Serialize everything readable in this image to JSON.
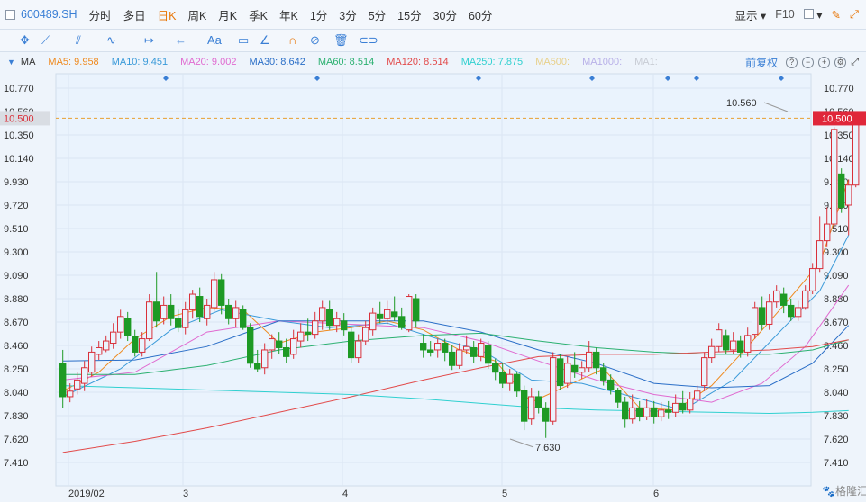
{
  "toolbar": {
    "symbol": "600489.SH",
    "periods": [
      "分时",
      "多日",
      "日K",
      "周K",
      "月K",
      "季K",
      "年K",
      "1分",
      "3分",
      "5分",
      "15分",
      "30分",
      "60分"
    ],
    "active_period": "日K",
    "display_label": "显示",
    "f10_label": "F10"
  },
  "drawing_tools": [
    "crosshair-icon",
    "line-icon",
    "channel-icon",
    "wave-icon",
    "range-icon",
    "arrow-icon",
    "text-icon",
    "comment-icon",
    "ruler-icon",
    "magnet-icon",
    "hide-icon",
    "delete-icon",
    "link-icon"
  ],
  "ma_bar": {
    "label": "MA",
    "items": [
      {
        "text": "MA5: 9.958",
        "color": "#ef8a1f"
      },
      {
        "text": "MA10: 9.451",
        "color": "#3a9ad9"
      },
      {
        "text": "MA20: 9.002",
        "color": "#e06ad0"
      },
      {
        "text": "MA30: 8.642",
        "color": "#2a6ec7"
      },
      {
        "text": "MA60: 8.514",
        "color": "#2bb070"
      },
      {
        "text": "MA120: 8.514",
        "color": "#e24a4a"
      },
      {
        "text": "MA250: 7.875",
        "color": "#30d0d0"
      },
      {
        "text": "MA500:",
        "color": "#e8d08a"
      },
      {
        "text": "MA1000:",
        "color": "#b8b0e8"
      },
      {
        "text": "MA1:",
        "color": "#c8ccd4"
      }
    ],
    "adjust_label": "前复权"
  },
  "chart_data": {
    "type": "candlestick",
    "y_ticks": [
      "10.770",
      "10.560",
      "10.350",
      "10.140",
      "9.930",
      "9.720",
      "9.510",
      "9.300",
      "9.090",
      "8.880",
      "8.670",
      "8.460",
      "8.250",
      "8.040",
      "7.830",
      "7.620",
      "7.410"
    ],
    "ylim": [
      7.3,
      10.85
    ],
    "x_labels": [
      "2019/02",
      "3",
      "4",
      "5",
      "6"
    ],
    "current_price_label": "10.500",
    "current_price": 10.5,
    "annotations": [
      {
        "text": "10.560",
        "value": 10.56
      },
      {
        "text": "7.630",
        "value": 7.63
      }
    ],
    "candles": [
      [
        8.3,
        8.0,
        8.42,
        7.9
      ],
      [
        8.0,
        8.05,
        8.12,
        7.95
      ],
      [
        8.07,
        8.15,
        8.22,
        8.02
      ],
      [
        8.12,
        8.26,
        8.32,
        8.05
      ],
      [
        8.22,
        8.4,
        8.45,
        8.18
      ],
      [
        8.38,
        8.44,
        8.5,
        8.33
      ],
      [
        8.42,
        8.5,
        8.55,
        8.4
      ],
      [
        8.48,
        8.58,
        8.66,
        8.43
      ],
      [
        8.58,
        8.72,
        8.78,
        8.52
      ],
      [
        8.7,
        8.55,
        8.76,
        8.5
      ],
      [
        8.54,
        8.4,
        8.6,
        8.36
      ],
      [
        8.4,
        8.52,
        8.58,
        8.36
      ],
      [
        8.52,
        8.85,
        8.92,
        8.5
      ],
      [
        8.85,
        8.68,
        9.12,
        8.62
      ],
      [
        8.7,
        8.82,
        8.9,
        8.65
      ],
      [
        8.82,
        8.7,
        8.92,
        8.64
      ],
      [
        8.7,
        8.62,
        8.78,
        8.58
      ],
      [
        8.62,
        8.78,
        8.85,
        8.56
      ],
      [
        8.78,
        8.92,
        8.96,
        8.7
      ],
      [
        8.9,
        8.72,
        8.98,
        8.67
      ],
      [
        8.7,
        8.82,
        8.88,
        8.64
      ],
      [
        8.8,
        9.05,
        9.12,
        8.77
      ],
      [
        9.05,
        8.82,
        9.1,
        8.74
      ],
      [
        8.82,
        8.7,
        8.88,
        8.65
      ],
      [
        8.7,
        8.8,
        8.86,
        8.62
      ],
      [
        8.78,
        8.62,
        8.82,
        8.6
      ],
      [
        8.62,
        8.3,
        8.66,
        8.26
      ],
      [
        8.3,
        8.25,
        8.42,
        8.22
      ],
      [
        8.26,
        8.42,
        8.48,
        8.2
      ],
      [
        8.42,
        8.52,
        8.56,
        8.34
      ],
      [
        8.5,
        8.44,
        8.58,
        8.38
      ],
      [
        8.44,
        8.36,
        8.52,
        8.3
      ],
      [
        8.38,
        8.52,
        8.6,
        8.34
      ],
      [
        8.5,
        8.58,
        8.66,
        8.44
      ],
      [
        8.58,
        8.56,
        8.7,
        8.5
      ],
      [
        8.56,
        8.68,
        8.76,
        8.52
      ],
      [
        8.68,
        8.8,
        8.86,
        8.6
      ],
      [
        8.78,
        8.64,
        8.86,
        8.6
      ],
      [
        8.64,
        8.7,
        8.76,
        8.58
      ],
      [
        8.68,
        8.6,
        8.75,
        8.55
      ],
      [
        8.58,
        8.35,
        8.62,
        8.3
      ],
      [
        8.35,
        8.5,
        8.56,
        8.3
      ],
      [
        8.5,
        8.62,
        8.68,
        8.46
      ],
      [
        8.6,
        8.75,
        8.8,
        8.55
      ],
      [
        8.74,
        8.7,
        8.85,
        8.66
      ],
      [
        8.7,
        8.78,
        8.86,
        8.65
      ],
      [
        8.76,
        8.72,
        8.9,
        8.68
      ],
      [
        8.72,
        8.62,
        8.8,
        8.6
      ],
      [
        8.6,
        8.9,
        8.92,
        8.58
      ],
      [
        8.88,
        8.68,
        8.92,
        8.62
      ],
      [
        8.48,
        8.42,
        8.56,
        8.35
      ],
      [
        8.42,
        8.4,
        8.5,
        8.36
      ],
      [
        8.42,
        8.48,
        8.52,
        8.35
      ],
      [
        8.48,
        8.4,
        8.52,
        8.32
      ],
      [
        8.4,
        8.28,
        8.46,
        8.24
      ],
      [
        8.28,
        8.42,
        8.48,
        8.25
      ],
      [
        8.42,
        8.45,
        8.55,
        8.38
      ],
      [
        8.44,
        8.36,
        8.5,
        8.3
      ],
      [
        8.36,
        8.48,
        8.52,
        8.32
      ],
      [
        8.46,
        8.3,
        8.5,
        8.25
      ],
      [
        8.3,
        8.22,
        8.34,
        8.15
      ],
      [
        8.22,
        8.12,
        8.3,
        8.08
      ],
      [
        8.12,
        8.2,
        8.25,
        8.05
      ],
      [
        8.2,
        8.05,
        8.22,
        8.0
      ],
      [
        8.06,
        7.78,
        8.1,
        7.7
      ],
      [
        7.8,
        8.0,
        8.08,
        7.75
      ],
      [
        8.0,
        7.9,
        8.05,
        7.85
      ],
      [
        7.9,
        7.78,
        7.95,
        7.63
      ],
      [
        7.78,
        8.35,
        8.4,
        7.75
      ],
      [
        8.34,
        8.1,
        8.38,
        8.06
      ],
      [
        8.12,
        8.3,
        8.36,
        8.08
      ],
      [
        8.28,
        8.22,
        8.4,
        8.17
      ],
      [
        8.22,
        8.26,
        8.32,
        8.16
      ],
      [
        8.26,
        8.4,
        8.5,
        8.22
      ],
      [
        8.4,
        8.26,
        8.44,
        8.2
      ],
      [
        8.26,
        8.15,
        8.3,
        8.1
      ],
      [
        8.15,
        8.06,
        8.2,
        8.02
      ],
      [
        8.06,
        7.95,
        8.08,
        7.9
      ],
      [
        7.95,
        7.8,
        8.0,
        7.72
      ],
      [
        7.8,
        7.9,
        8.02,
        7.76
      ],
      [
        7.9,
        7.82,
        7.96,
        7.78
      ],
      [
        7.82,
        7.9,
        7.98,
        7.79
      ],
      [
        7.9,
        7.82,
        7.96,
        7.76
      ],
      [
        7.82,
        7.88,
        7.95,
        7.78
      ],
      [
        7.88,
        7.86,
        7.96,
        7.8
      ],
      [
        7.86,
        7.94,
        8.02,
        7.82
      ],
      [
        7.94,
        7.88,
        8.05,
        7.85
      ],
      [
        7.88,
        7.98,
        8.04,
        7.85
      ],
      [
        7.98,
        8.05,
        8.1,
        7.95
      ],
      [
        8.1,
        8.35,
        8.4,
        8.05
      ],
      [
        8.35,
        8.45,
        8.52,
        8.3
      ],
      [
        8.45,
        8.6,
        8.66,
        8.4
      ],
      [
        8.55,
        8.42,
        8.6,
        8.38
      ],
      [
        8.42,
        8.5,
        8.58,
        8.38
      ],
      [
        8.5,
        8.4,
        8.55,
        8.35
      ],
      [
        8.4,
        8.55,
        8.62,
        8.36
      ],
      [
        8.56,
        8.8,
        8.85,
        8.52
      ],
      [
        8.8,
        8.65,
        8.9,
        8.6
      ],
      [
        8.65,
        8.85,
        8.92,
        8.6
      ],
      [
        8.85,
        8.95,
        9.0,
        8.8
      ],
      [
        8.92,
        8.82,
        8.98,
        8.75
      ],
      [
        8.82,
        8.72,
        8.88,
        8.68
      ],
      [
        8.72,
        8.8,
        8.86,
        8.68
      ],
      [
        8.8,
        8.95,
        9.0,
        8.78
      ],
      [
        8.95,
        9.15,
        9.2,
        8.92
      ],
      [
        9.15,
        9.4,
        9.62,
        9.12
      ],
      [
        9.4,
        9.55,
        9.7,
        9.35
      ],
      [
        9.55,
        10.4,
        10.42,
        9.5
      ],
      [
        10.0,
        9.7,
        10.05,
        9.65
      ],
      [
        9.72,
        9.9,
        9.95,
        9.45
      ],
      [
        9.9,
        10.5,
        10.56,
        9.88
      ]
    ],
    "ma_lines": [
      {
        "name": "MA5",
        "color": "#ef8a1f",
        "values": [
          [
            0,
            8.05
          ],
          [
            5,
            8.22
          ],
          [
            10,
            8.52
          ],
          [
            15,
            8.72
          ],
          [
            20,
            8.8
          ],
          [
            25,
            8.78
          ],
          [
            30,
            8.48
          ],
          [
            35,
            8.58
          ],
          [
            40,
            8.62
          ],
          [
            45,
            8.68
          ],
          [
            50,
            8.6
          ],
          [
            55,
            8.42
          ],
          [
            60,
            8.32
          ],
          [
            65,
            7.95
          ],
          [
            70,
            8.1
          ],
          [
            75,
            8.25
          ],
          [
            80,
            7.9
          ],
          [
            85,
            7.88
          ],
          [
            90,
            8.1
          ],
          [
            95,
            8.45
          ],
          [
            100,
            8.82
          ],
          [
            105,
            9.2
          ],
          [
            109,
            9.95
          ]
        ]
      },
      {
        "name": "MA10",
        "color": "#3a9ad9",
        "values": [
          [
            0,
            8.0
          ],
          [
            8,
            8.25
          ],
          [
            15,
            8.6
          ],
          [
            22,
            8.78
          ],
          [
            30,
            8.68
          ],
          [
            37,
            8.62
          ],
          [
            45,
            8.66
          ],
          [
            52,
            8.52
          ],
          [
            58,
            8.42
          ],
          [
            65,
            8.15
          ],
          [
            72,
            8.12
          ],
          [
            79,
            8.0
          ],
          [
            86,
            7.88
          ],
          [
            93,
            8.15
          ],
          [
            100,
            8.62
          ],
          [
            105,
            8.95
          ],
          [
            109,
            9.45
          ]
        ]
      },
      {
        "name": "MA20",
        "color": "#e06ad0",
        "values": [
          [
            0,
            8.15
          ],
          [
            10,
            8.22
          ],
          [
            20,
            8.58
          ],
          [
            30,
            8.68
          ],
          [
            40,
            8.65
          ],
          [
            50,
            8.62
          ],
          [
            58,
            8.5
          ],
          [
            66,
            8.32
          ],
          [
            74,
            8.15
          ],
          [
            82,
            8.02
          ],
          [
            90,
            7.95
          ],
          [
            97,
            8.12
          ],
          [
            103,
            8.45
          ],
          [
            109,
            9.0
          ]
        ]
      },
      {
        "name": "MA30",
        "color": "#2a6ec7",
        "values": [
          [
            0,
            8.32
          ],
          [
            10,
            8.33
          ],
          [
            20,
            8.45
          ],
          [
            30,
            8.68
          ],
          [
            40,
            8.68
          ],
          [
            50,
            8.68
          ],
          [
            58,
            8.58
          ],
          [
            66,
            8.42
          ],
          [
            74,
            8.3
          ],
          [
            82,
            8.12
          ],
          [
            90,
            8.08
          ],
          [
            98,
            8.1
          ],
          [
            104,
            8.3
          ],
          [
            109,
            8.64
          ]
        ]
      },
      {
        "name": "MA60",
        "color": "#2bb070",
        "values": [
          [
            0,
            8.2
          ],
          [
            10,
            8.2
          ],
          [
            20,
            8.28
          ],
          [
            30,
            8.42
          ],
          [
            40,
            8.5
          ],
          [
            50,
            8.55
          ],
          [
            58,
            8.57
          ],
          [
            66,
            8.5
          ],
          [
            74,
            8.44
          ],
          [
            82,
            8.4
          ],
          [
            90,
            8.38
          ],
          [
            98,
            8.38
          ],
          [
            104,
            8.42
          ],
          [
            109,
            8.51
          ]
        ]
      },
      {
        "name": "MA120",
        "color": "#e24a4a",
        "values": [
          [
            0,
            7.5
          ],
          [
            10,
            7.6
          ],
          [
            20,
            7.72
          ],
          [
            30,
            7.86
          ],
          [
            40,
            8.0
          ],
          [
            50,
            8.15
          ],
          [
            58,
            8.26
          ],
          [
            66,
            8.36
          ],
          [
            74,
            8.38
          ],
          [
            82,
            8.38
          ],
          [
            90,
            8.4
          ],
          [
            98,
            8.42
          ],
          [
            104,
            8.45
          ],
          [
            109,
            8.51
          ]
        ]
      },
      {
        "name": "MA250",
        "color": "#30d0d0",
        "values": [
          [
            0,
            8.1
          ],
          [
            10,
            8.08
          ],
          [
            20,
            8.06
          ],
          [
            30,
            8.04
          ],
          [
            40,
            8.02
          ],
          [
            50,
            7.98
          ],
          [
            58,
            7.94
          ],
          [
            66,
            7.9
          ],
          [
            74,
            7.88
          ],
          [
            82,
            7.87
          ],
          [
            90,
            7.86
          ],
          [
            98,
            7.85
          ],
          [
            104,
            7.86
          ],
          [
            109,
            7.875
          ]
        ]
      }
    ],
    "grid": true
  },
  "footer": {
    "watermark": "格隆汇"
  }
}
